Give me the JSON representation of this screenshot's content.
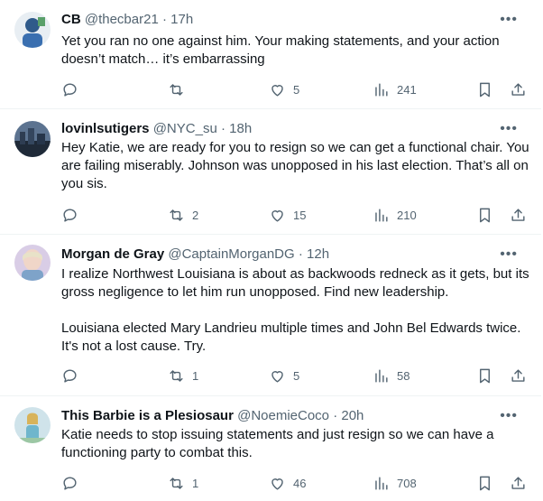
{
  "tweets": [
    {
      "name": "CB",
      "handle": "@thecbar21",
      "dot": "·",
      "time": "17h",
      "text": [
        "Yet you ran no one against him. Your making statements, and  your action doesn’t match… it’s embarrassing"
      ],
      "replies": "",
      "retweets": "",
      "likes": "5",
      "views": "241",
      "avatar_color": "#3a6fb0"
    },
    {
      "name": "lovinlsutigers",
      "handle": "@NYC_su",
      "dot": "·",
      "time": "18h",
      "text": [
        "Hey Katie, we are ready for you to resign so we can get a functional chair. You are failing miserably. Johnson was unopposed in his last election. That’s all on you sis."
      ],
      "replies": "",
      "retweets": "2",
      "likes": "15",
      "views": "210",
      "avatar_color": "#2c3a4f"
    },
    {
      "name": "Morgan de Gray",
      "handle": "@CaptainMorganDG",
      "dot": "·",
      "time": "12h",
      "text": [
        "I realize Northwest Louisiana is about as backwoods redneck as it gets, but its gross negligence to let him run unopposed. Find new leadership.",
        "Louisiana elected Mary Landrieu multiple times and John Bel Edwards twice. It's not a lost cause. Try."
      ],
      "replies": "",
      "retweets": "1",
      "likes": "5",
      "views": "58",
      "avatar_color": "#c9b8d8"
    },
    {
      "name": "This Barbie is a Plesiosaur",
      "handle": "@NoemieCoco",
      "dot": "·",
      "time": "20h",
      "text": [
        "Katie needs to stop issuing statements and just resign so we can have a functioning party to combat this."
      ],
      "replies": "",
      "retweets": "1",
      "likes": "46",
      "views": "708",
      "avatar_color": "#7fb7c9"
    }
  ],
  "icons": {
    "reply": "reply-icon",
    "retweet": "retweet-icon",
    "like": "heart-icon",
    "views": "views-icon",
    "bookmark": "bookmark-icon",
    "share": "share-icon",
    "more": "more-icon"
  }
}
